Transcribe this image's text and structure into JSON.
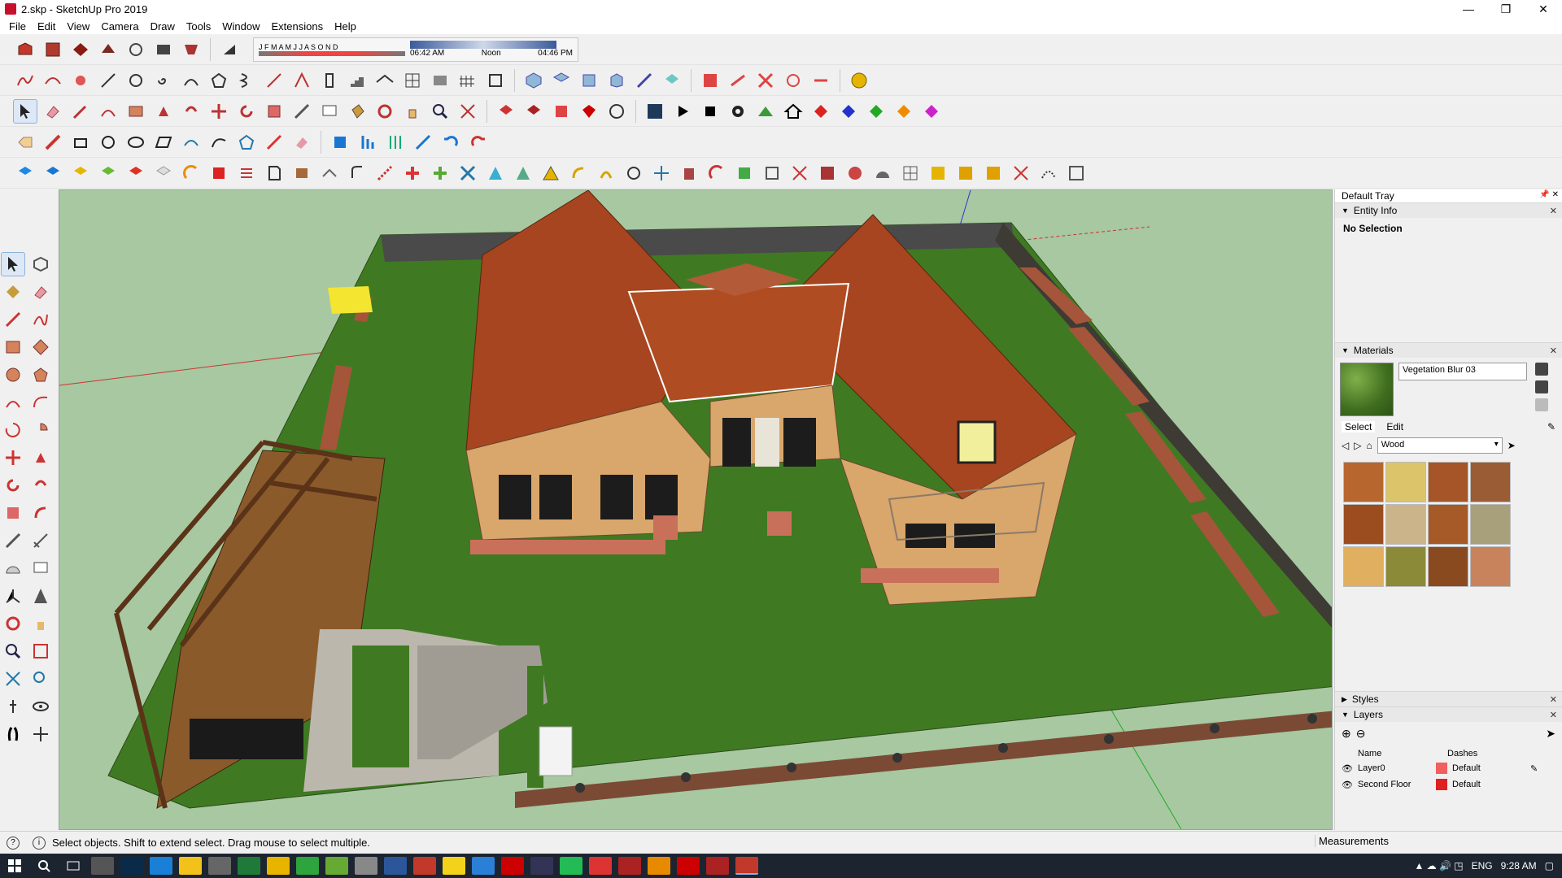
{
  "window": {
    "title": "2.skp - SketchUp Pro 2019",
    "controls": [
      "—",
      "❐",
      "✕"
    ]
  },
  "menu": [
    "File",
    "Edit",
    "View",
    "Camera",
    "Draw",
    "Tools",
    "Window",
    "Extensions",
    "Help"
  ],
  "shadow": {
    "months": "J F M A M J J A S O N D",
    "time_start": "06:42 AM",
    "time_mid": "Noon",
    "time_end": "04:46 PM"
  },
  "tray": {
    "title": "Default Tray",
    "entity_info": {
      "header": "Entity Info",
      "body": "No Selection"
    },
    "materials": {
      "header": "Materials",
      "current_name": "Vegetation Blur 03",
      "tab_select": "Select",
      "tab_edit": "Edit",
      "library": "Wood",
      "swatch_colors": [
        "#b7662e",
        "#dcc46a",
        "#a55527",
        "#9a5c34",
        "#9b4d1f",
        "#ccb48a",
        "#a65a28",
        "#a8a07a",
        "#e0b060",
        "#8a8a38",
        "#8a4a20",
        "#c9835c"
      ]
    },
    "styles": {
      "header": "Styles"
    },
    "layers": {
      "header": "Layers",
      "col_name": "Name",
      "col_dashes": "Dashes",
      "rows": [
        {
          "name": "Layer0",
          "color": "#f06060",
          "dashes": "Default"
        },
        {
          "name": "Second Floor",
          "color": "#e02020",
          "dashes": "Default"
        }
      ]
    }
  },
  "status": {
    "hint": "Select objects. Shift to extend select. Drag mouse to select multiple.",
    "measurements_label": "Measurements"
  },
  "taskbar": {
    "lang": "ENG",
    "time": "9:28 AM"
  },
  "colors": {
    "viewport_bg": "#a7c8a1",
    "grass": "#3f7a22",
    "roof": "#a6451f",
    "wall": "#d9a66c",
    "taskbar": "#1c2430"
  }
}
